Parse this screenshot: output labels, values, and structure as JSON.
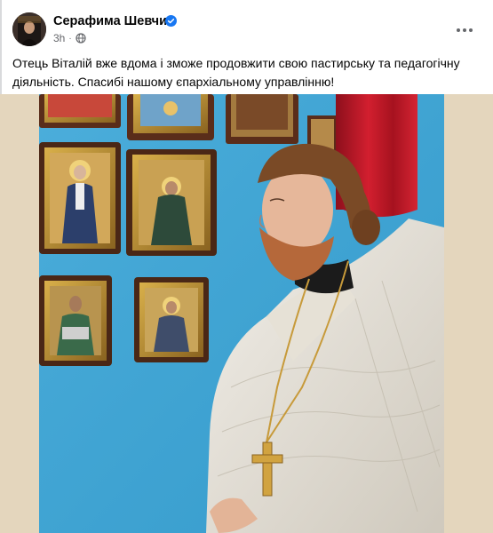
{
  "post": {
    "author": "Серафима Шевчик",
    "verified": true,
    "time": "3h",
    "privacy_icon": "globe-icon",
    "more_icon": "more-dots-icon",
    "text": "Отець Віталій вже вдома і зможе продовжити свою пастирську та педагогічну діяльність. Спасибі нашому єпархіальному управлінню!"
  },
  "colors": {
    "verified_badge": "#1877f2",
    "secondary_text": "#65676b",
    "wall_blue": "#3fa8d8",
    "curtain_red": "#c7192a",
    "vestment": "#e8e4dc"
  }
}
